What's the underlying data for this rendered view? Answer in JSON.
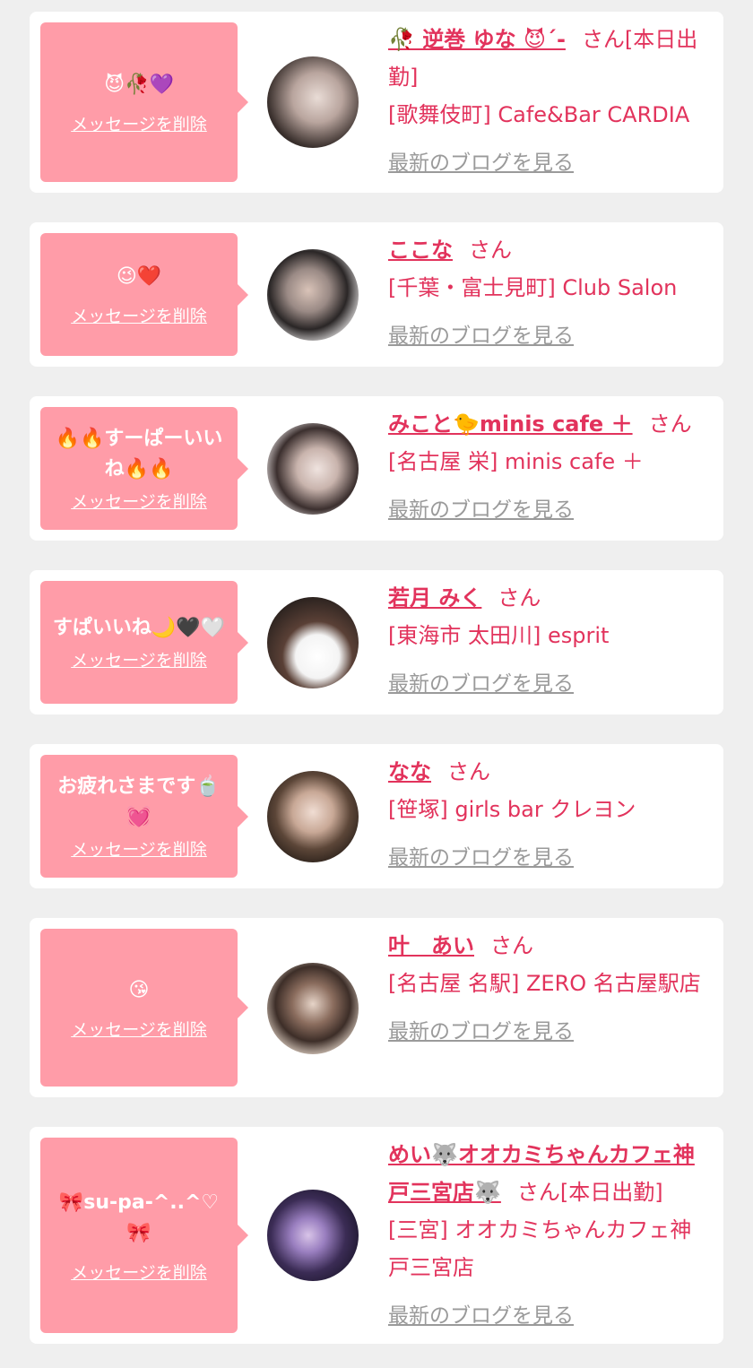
{
  "delete_label": "メッセージを削除",
  "blog_label": "最新のブログを見る",
  "cards": [
    {
      "message": "😈🥀💜",
      "name": "🥀 逆巻 ゆな 😈ˊ-",
      "suffix": "さん[本日出勤]",
      "shop": "[歌舞伎町] Cafe&Bar CARDIA"
    },
    {
      "message": "😉❤️",
      "name": "ここな",
      "suffix": "さん",
      "shop": "[千葉・富士見町] Club Salon"
    },
    {
      "message": "🔥🔥すーぱーいいね🔥🔥",
      "name": "みこと🐤minis cafe ＋",
      "suffix": "さん",
      "shop": "[名古屋 栄] minis cafe ＋"
    },
    {
      "message": "すぱいいね🌙🖤🤍",
      "name": "若月 みく",
      "suffix": "さん",
      "shop": "[東海市 太田川] esprit"
    },
    {
      "message": "お疲れさまです🍵💓",
      "name": "なな",
      "suffix": "さん",
      "shop": "[笹塚] girls bar クレヨン"
    },
    {
      "message": "😘",
      "name": "叶　あい",
      "suffix": "さん",
      "shop": "[名古屋 名駅] ZERO 名古屋駅店"
    },
    {
      "message": "🎀su-pa-^..^♡🎀",
      "name": "めい🐺オオカミちゃんカフェ神戸三宮店🐺",
      "suffix": "さん[本日出勤]",
      "shop": "[三宮] オオカミちゃんカフェ神戸三宮店"
    }
  ]
}
